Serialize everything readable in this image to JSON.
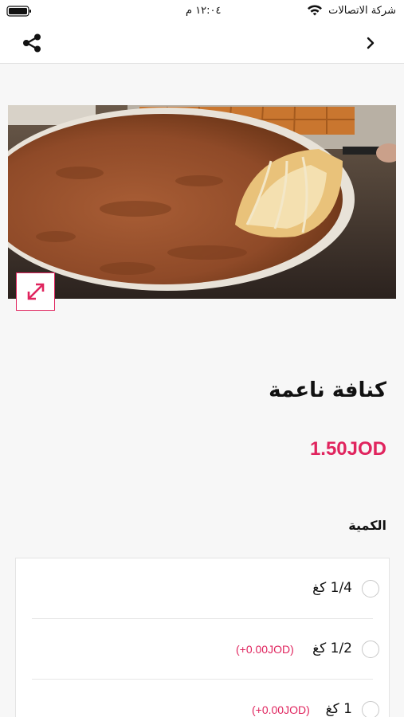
{
  "status_bar": {
    "carrier": "شركة الاتصالات",
    "time": "١٢:٠٤ م"
  },
  "nav": {
    "share_icon": "share-icon",
    "back_icon": "chevron-right-icon"
  },
  "product": {
    "title": "كنافة ناعمة",
    "price": "1.50JOD",
    "image_alt": "knafeh photo",
    "expand_icon": "expand-arrows-icon"
  },
  "quantity": {
    "label": "الكمية",
    "options": [
      {
        "label": "1/4 كغ",
        "extra": ""
      },
      {
        "label": "1/2 كغ",
        "extra": "(+0.00JOD)"
      },
      {
        "label": "1 كغ",
        "extra": "(+0.00JOD)"
      }
    ]
  },
  "colors": {
    "accent": "#e0245e",
    "background": "#f7f7f7"
  }
}
